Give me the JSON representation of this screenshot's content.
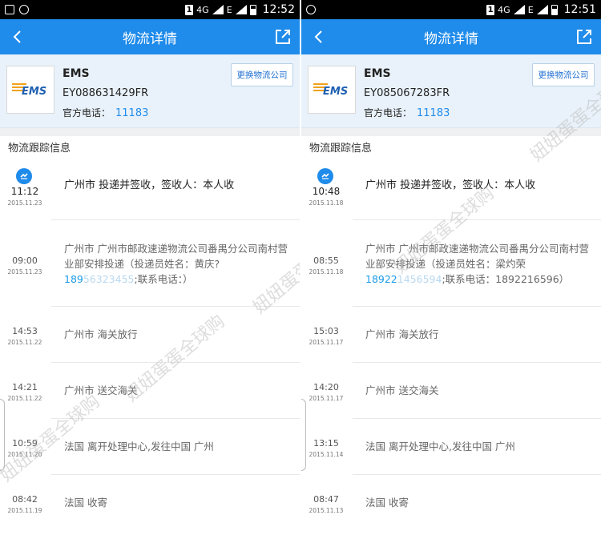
{
  "screens": [
    {
      "status": {
        "sim": "1",
        "net": "4G",
        "net_sub": "E",
        "clock": "12:52"
      },
      "nav": {
        "title": "物流详情"
      },
      "carrier": {
        "logo_text": "EMS",
        "name": "EMS",
        "tracking_no": "EY088631429FR",
        "phone_label": "官方电话：",
        "phone": "11183",
        "change_button": "更换物流公司"
      },
      "section_title": "物流跟踪信息",
      "events": [
        {
          "time": "11:12",
          "date": "2015.11.23",
          "text": "广州市 投递并签收，签收人：本人收",
          "active": true
        },
        {
          "time": "09:00",
          "date": "2015.11.23",
          "text": "广州市 广州市邮政速递物流公司番禺分公司南村营业部安排投递（投递员姓名：黄庆?",
          "phone_visible": "189",
          "phone_blurred": "56323455",
          "text_tail": ";联系电话：）"
        },
        {
          "time": "14:53",
          "date": "2015.11.22",
          "text": "广州市 海关放行"
        },
        {
          "time": "14:21",
          "date": "2015.11.22",
          "text": "广州市 送交海关"
        },
        {
          "time": "10:59",
          "date": "2015.11.20",
          "text": "法国 离开处理中心,发往中国 广州"
        },
        {
          "time": "08:42",
          "date": "2015.11.19",
          "text": "法国 收寄"
        }
      ]
    },
    {
      "status": {
        "sim": "1",
        "net": "4G",
        "net_sub": "E",
        "clock": "12:51"
      },
      "nav": {
        "title": "物流详情"
      },
      "carrier": {
        "logo_text": "EMS",
        "name": "EMS",
        "tracking_no": "EY085067283FR",
        "phone_label": "官方电话：",
        "phone": "11183",
        "change_button": "更换物流公司"
      },
      "section_title": "物流跟踪信息",
      "events": [
        {
          "time": "10:48",
          "date": "2015.11.18",
          "text": "广州市 投递并签收，签收人：本人收",
          "active": true
        },
        {
          "time": "08:55",
          "date": "2015.11.18",
          "text": "广州市 广州市邮政速递物流公司番禺分公司南村营业部安排投递（投递员姓名：梁灼荣",
          "phone_visible": "18922",
          "phone_blurred": "1456594",
          "text_tail": ";联系电话：1892216596）"
        },
        {
          "time": "15:03",
          "date": "2015.11.17",
          "text": "广州市 海关放行"
        },
        {
          "time": "14:20",
          "date": "2015.11.17",
          "text": "广州市 送交海关"
        },
        {
          "time": "13:15",
          "date": "2015.11.14",
          "text": "法国 离开处理中心,发往中国 广州"
        },
        {
          "time": "08:47",
          "date": "2015.11.13",
          "text": "法国 收寄"
        }
      ]
    }
  ],
  "watermark": "妞妞蛋蛋全球购",
  "colors": {
    "nav": "#1f8bea",
    "link": "#1f8bea",
    "header_bg": "#e9f2fa"
  }
}
